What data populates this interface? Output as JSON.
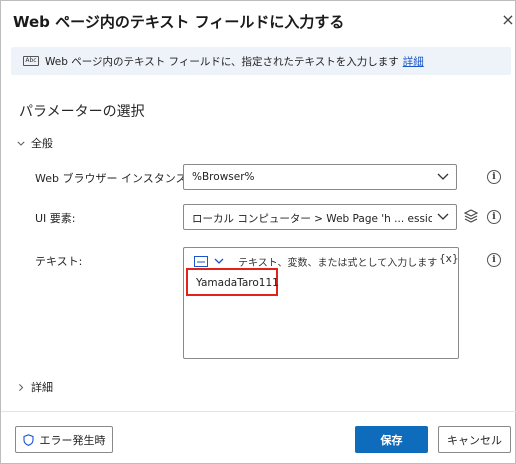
{
  "dialog": {
    "title": "Web ページ内のテキスト フィールドに入力する",
    "close_icon": "×"
  },
  "info": {
    "icon_label": "Abc",
    "text": "Web ページ内のテキスト フィールドに、指定されたテキストを入力します",
    "link": "詳細"
  },
  "params": {
    "section_title": "パラメーターの選択",
    "group_title": "全般",
    "browser_label": "Web ブラウザー インスタンス:",
    "browser_value": "%Browser%",
    "ui_label": "UI 要素:",
    "ui_value": "ローカル コンピューター > Web Page 'h ... ession/new' > Ir",
    "text_label": "テキスト:",
    "text_hint": "テキスト、変数、または式として入力します",
    "text_var_button": "{x}",
    "text_value": "YamadaTaro111",
    "info_glyph": "i",
    "details_title": "詳細"
  },
  "footer": {
    "error_button": "エラー発生時",
    "save_button": "保存",
    "cancel_button": "キャンセル"
  },
  "colors": {
    "accent": "#0f6cbd",
    "highlight_border": "#e2231a",
    "info_bar_bg": "#eef2f9"
  },
  "icons": {
    "close": "close-icon",
    "info_bar": "text-field-icon",
    "expand": "chevron-down-icon",
    "collapse": "chevron-right-icon",
    "dropdown": "chevron-down-icon",
    "layers": "layers-icon",
    "info": "info-icon",
    "shield": "shield-icon",
    "text_mode": "text-mode-icon"
  }
}
